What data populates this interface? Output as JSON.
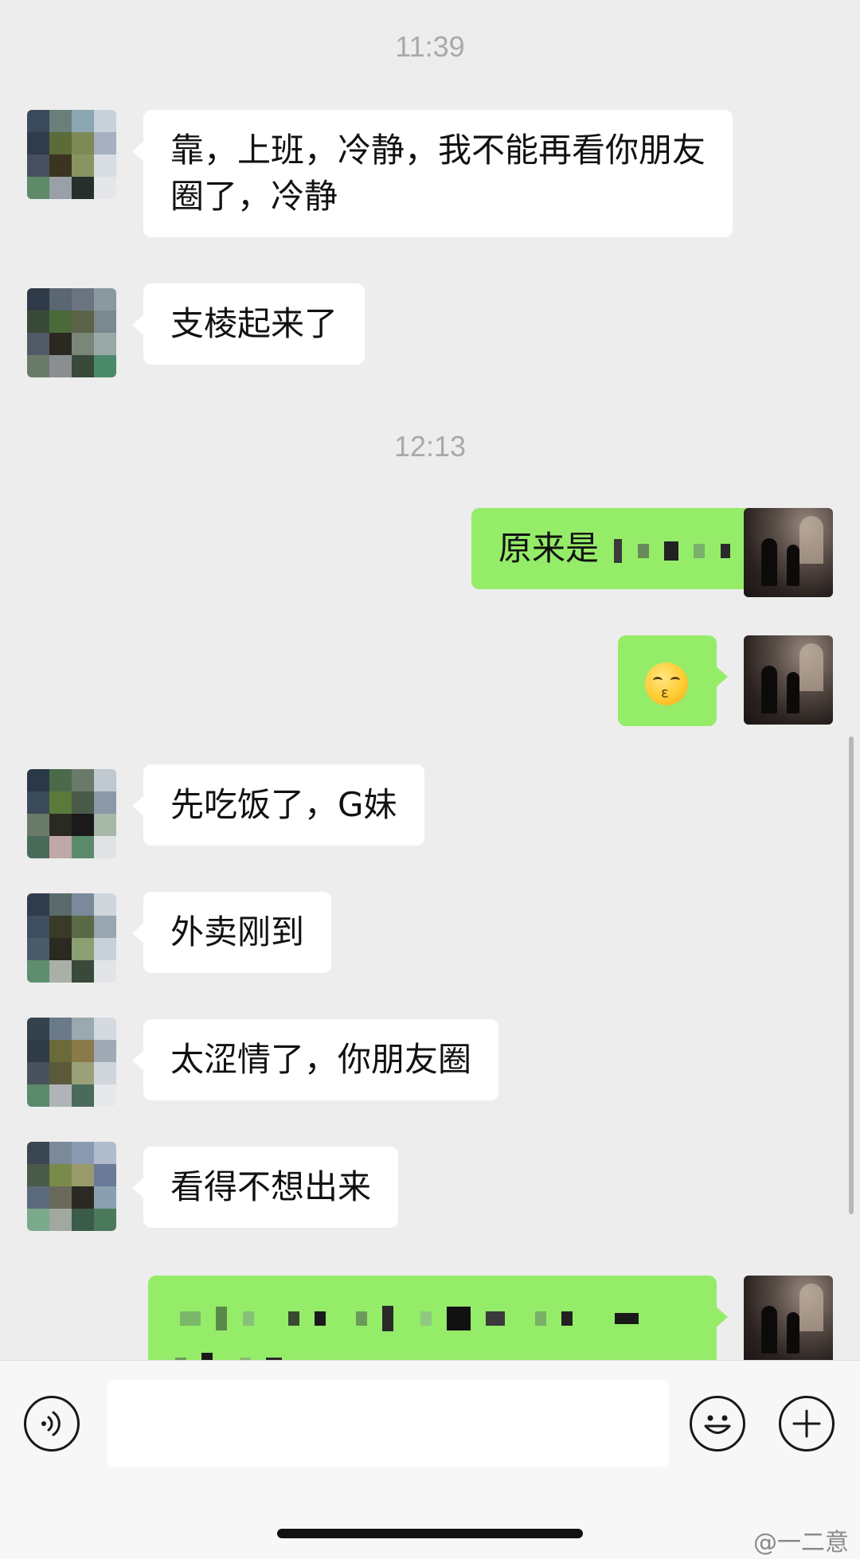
{
  "timestamps": [
    "11:39",
    "12:13"
  ],
  "messages": [
    {
      "side": "left",
      "text": "靠，上班，冷静，我不能再看你朋友圈了，冷静"
    },
    {
      "side": "left",
      "text": "支棱起来了"
    },
    {
      "side": "right",
      "text": "原来是"
    },
    {
      "side": "right",
      "emoji": "kissing-face-emoji"
    },
    {
      "side": "left",
      "text": "先吃饭了，G妹"
    },
    {
      "side": "left",
      "text": "外卖刚到"
    },
    {
      "side": "left",
      "text": "太涩情了，你朋友圈"
    },
    {
      "side": "left",
      "text": "看得不想出来"
    }
  ],
  "input": {
    "placeholder": ""
  },
  "icons": {
    "voice": "voice-icon",
    "emoji": "emoji-icon",
    "add": "plus-icon"
  },
  "watermark": "@一二意",
  "colors": {
    "background": "#ededed",
    "incoming_bubble": "#ffffff",
    "outgoing_bubble": "#95ec69",
    "timestamp": "#a9a9a9"
  }
}
